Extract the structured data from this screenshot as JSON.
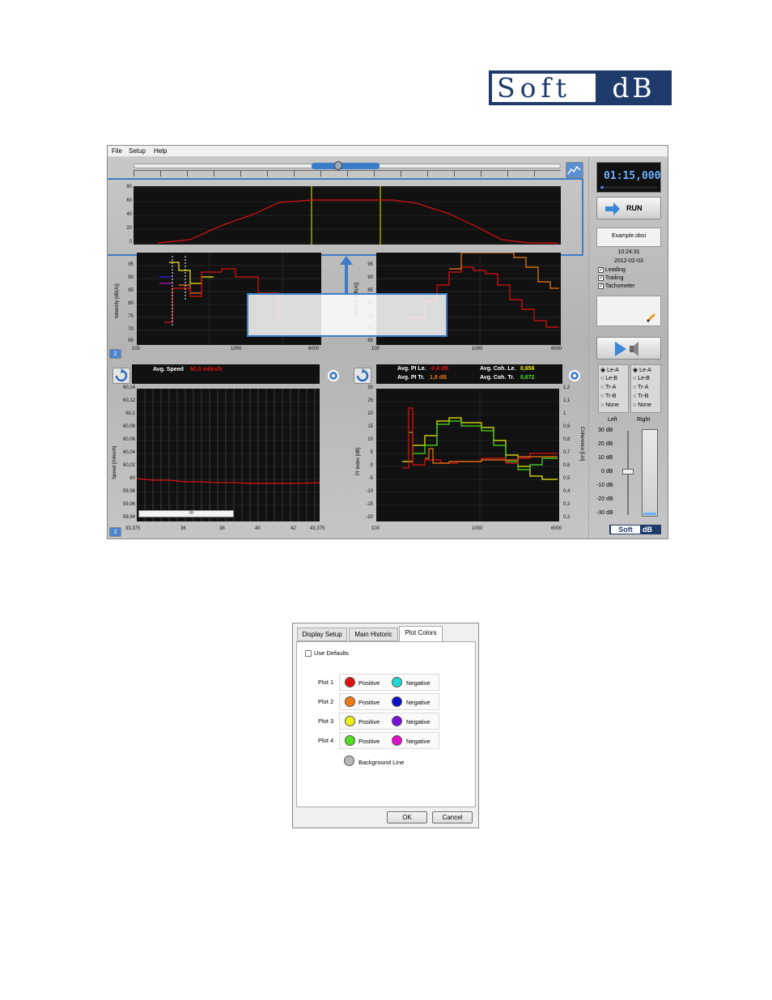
{
  "logo": {
    "soft": "Soft",
    "db": "dB"
  },
  "menu": {
    "file": "File",
    "setup": "Setup",
    "help": "Help"
  },
  "top_plot": {
    "y_ticks": [
      "80",
      "60",
      "40",
      "20",
      "0"
    ]
  },
  "plot_il": {
    "ylabel": "Intensity [dB(A)]",
    "y_ticks": [
      "95",
      "90",
      "85",
      "80",
      "75",
      "70",
      "65"
    ],
    "x_ticks": [
      "100",
      "1000",
      "6000"
    ],
    "page": "2"
  },
  "plot_pr": {
    "ylabel": "Pressure [dB(A)]",
    "y_ticks": [
      "95",
      "90",
      "85",
      "80",
      "75",
      "70",
      "65"
    ],
    "x_ticks": [
      "100",
      "1000",
      "6000"
    ]
  },
  "speed": {
    "label": "Avg. Speed",
    "value": "60,0 miles/h",
    "ylabel": "Speed [miles/h]",
    "y_ticks": [
      "60,14",
      "60,12",
      "60,1",
      "60,08",
      "60,06",
      "60,04",
      "60,02",
      "60",
      "59,98",
      "59,96",
      "59,94"
    ],
    "x_ticks": [
      "33,375",
      "36",
      "38",
      "40",
      "42",
      "43,375"
    ],
    "scroll_thumb": "III",
    "page": "2"
  },
  "pi": {
    "pi_le_label": "Avg. PI Le.",
    "pi_le": "-0,4 dB",
    "pi_tr_label": "Avg. PI Tr.",
    "pi_tr": "1,8 dB",
    "coh_le_label": "Avg. Coh. Le.",
    "coh_le": "0,656",
    "coh_tr_label": "Avg. Coh. Tr.",
    "coh_tr": "0,672",
    "ylabel": "PI Index [dB]",
    "y2label": "Coherence [Lin]",
    "y_ticks": [
      "30",
      "25",
      "20",
      "15",
      "10",
      "5",
      "0",
      "-5",
      "-10",
      "-15",
      "-20"
    ],
    "y2_ticks": [
      "1,2",
      "1,1",
      "1",
      "0,9",
      "0,8",
      "0,7",
      "0,6",
      "0,5",
      "0,4",
      "0,3",
      "0,2"
    ],
    "x_ticks": [
      "100",
      "1000",
      "6000"
    ]
  },
  "side": {
    "time": "01:15,000",
    "run": "RUN",
    "file": "Example.obsi",
    "clock": "10:24:31",
    "date": "2012-02-03",
    "chk_leading": "Leading",
    "chk_trailing": "Trailing",
    "chk_tacho": "Tachometer",
    "radios": [
      "Le-A",
      "Le-B",
      "Tr-A",
      "Tr-B",
      "None"
    ],
    "left": "Left",
    "right": "Right",
    "db_ticks": [
      "30 dB",
      "20 dB",
      "10 dB",
      "0 dB",
      "-10 dB",
      "-20 dB",
      "-30 dB"
    ],
    "brand_soft": "Soft",
    "brand_db": "dB"
  },
  "dialog": {
    "tabs": [
      "Display Setup",
      "Main Historic",
      "Plot Colors"
    ],
    "use_defaults": "Use Defaults",
    "plots": [
      {
        "label": "Plot 1",
        "pos": "Positive",
        "neg": "Negative",
        "pos_color": "#e01010",
        "neg_color": "#22d8d8"
      },
      {
        "label": "Plot 2",
        "pos": "Positive",
        "neg": "Negative",
        "pos_color": "#f07a10",
        "neg_color": "#1010c8"
      },
      {
        "label": "Plot 3",
        "pos": "Positive",
        "neg": "Negative",
        "pos_color": "#f0f010",
        "neg_color": "#7a10d8"
      },
      {
        "label": "Plot 4",
        "pos": "Positive",
        "neg": "Negative",
        "pos_color": "#50e020",
        "neg_color": "#e010c8"
      }
    ],
    "background_line": "Background Line",
    "bg_color": "#b8b8b8",
    "ok": "OK",
    "cancel": "Cancel"
  },
  "colors": {
    "accent": "#3a7cc8",
    "highlight": "#3d7dc7"
  }
}
